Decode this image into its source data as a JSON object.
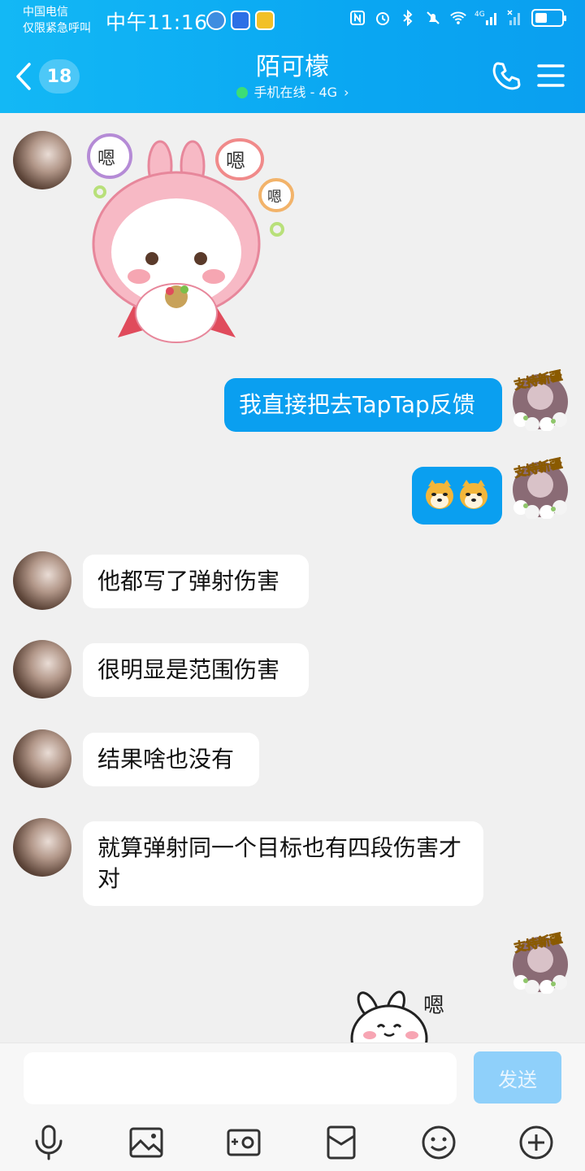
{
  "status_bar": {
    "carrier_line1": "中国电信",
    "carrier_line2": "仅限紧急呼叫",
    "time": "中午11:16",
    "network_label": "4G",
    "battery_level": 0.45
  },
  "header": {
    "unread_count": "18",
    "title": "陌可檬",
    "subtitle": "手机在线 - 4G",
    "subtitle_chevron": "›"
  },
  "sticker_texts": {
    "en": "嗯"
  },
  "messages": [
    {
      "side": "in",
      "type": "sticker",
      "text": ""
    },
    {
      "side": "out",
      "type": "text",
      "text": "我直接把去TapTap反馈"
    },
    {
      "side": "out",
      "type": "emoji",
      "text": ""
    },
    {
      "side": "in",
      "type": "text",
      "text": "他都写了弹射伤害"
    },
    {
      "side": "in",
      "type": "text",
      "text": "很明显是范围伤害"
    },
    {
      "side": "in",
      "type": "text",
      "text": "结果啥也没有"
    },
    {
      "side": "in",
      "type": "text",
      "text": "就算弹射同一个目标也有四段伤害才对"
    },
    {
      "side": "out",
      "type": "sticker",
      "text": ""
    }
  ],
  "my_avatar_caption": "支持新疆",
  "input": {
    "placeholder": "",
    "send_label": "发送"
  },
  "toolbar": [
    "microphone-icon",
    "photo-icon",
    "camera-icon",
    "red-packet-icon",
    "emoji-icon",
    "plus-icon"
  ],
  "colors": {
    "header": "#0aa7f2",
    "outgoing_bubble": "#0a9ff0",
    "send_disabled": "#8fd0fa",
    "background": "#f0f0f0"
  }
}
